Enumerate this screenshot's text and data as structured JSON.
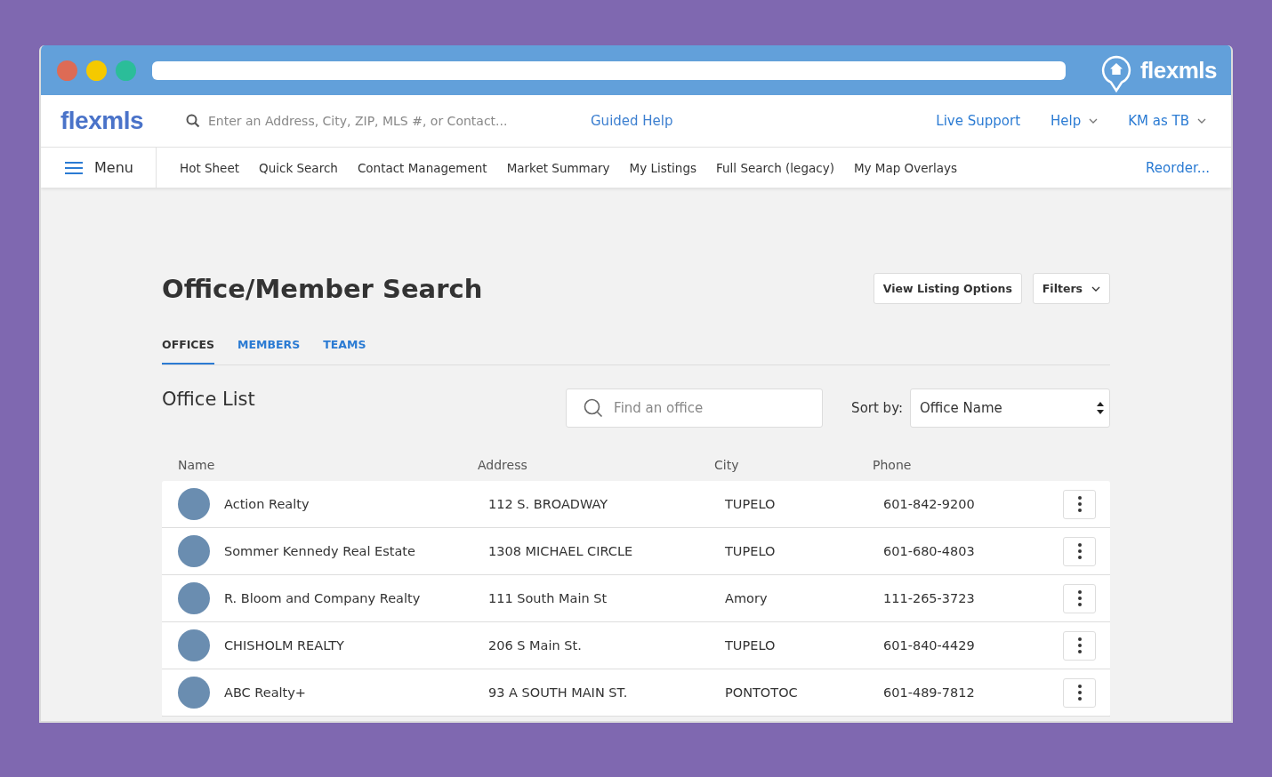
{
  "browser": {
    "brand": "flexmls"
  },
  "header": {
    "logo": "flexmls",
    "search": {
      "placeholder": "Enter an Address, City, ZIP, MLS #, or Contact..."
    },
    "guided_help": "Guided Help",
    "links": [
      {
        "label": "Live Support",
        "dropdown": false
      },
      {
        "label": "Help",
        "dropdown": true
      },
      {
        "label": "KM as TB",
        "dropdown": true
      }
    ]
  },
  "nav": {
    "menu": "Menu",
    "items": [
      "Hot Sheet",
      "Quick Search",
      "Contact Management",
      "Market Summary",
      "My Listings",
      "Full Search (legacy)",
      "My Map Overlays"
    ],
    "reorder": "Reorder..."
  },
  "page": {
    "title": "Office/Member Search",
    "buttons": [
      {
        "label": "View Listing Options",
        "dropdown": false
      },
      {
        "label": "Filters",
        "dropdown": true
      }
    ],
    "tabs": [
      {
        "label": "OFFICES",
        "selected": true
      },
      {
        "label": "MEMBERS",
        "selected": false
      },
      {
        "label": "TEAMS",
        "selected": false
      }
    ],
    "list_title": "Office List",
    "search": {
      "placeholder": "Find an office"
    },
    "sort_label": "Sort by:",
    "sort_value": "Office Name"
  },
  "table": {
    "columns": [
      "Name",
      "Address",
      "City",
      "Phone"
    ],
    "rows": [
      {
        "name": "Action Realty",
        "address": "112 S. BROADWAY",
        "city": "TUPELO",
        "phone": "601-842-9200"
      },
      {
        "name": "Sommer Kennedy Real Estate",
        "address": "1308 MICHAEL CIRCLE",
        "city": "TUPELO",
        "phone": "601-680-4803"
      },
      {
        "name": "R. Bloom and Company Realty",
        "address": "111 South Main St",
        "city": "Amory",
        "phone": "111-265-3723"
      },
      {
        "name": "CHISHOLM REALTY",
        "address": "206 S Main St.",
        "city": "TUPELO",
        "phone": "601-840-4429"
      },
      {
        "name": "ABC Realty+",
        "address": "93 A SOUTH MAIN ST.",
        "city": "PONTOTOC",
        "phone": "601-489-7812"
      }
    ]
  }
}
